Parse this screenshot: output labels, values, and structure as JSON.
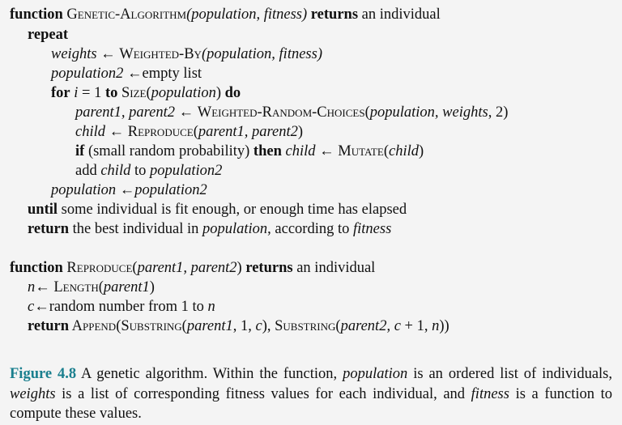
{
  "colors": {
    "background": "#f4f4f4",
    "text": "#111111",
    "figure_label": "#1a7f8e"
  },
  "algorithm1": {
    "header": {
      "kw_function": "function",
      "name": "Genetic-Algorithm",
      "params": "(population, fitness)",
      "kw_returns": "returns",
      "returns_text": "an individual"
    },
    "l_repeat": {
      "kw": "repeat"
    },
    "l_weights": {
      "var": "weights",
      "arrow": "←",
      "fn": "Weighted-By",
      "args": "(population, fitness)"
    },
    "l_pop2": {
      "var": "population2",
      "arrow": "←",
      "rest": "empty list"
    },
    "l_for": {
      "kw_for": "for",
      "iter": "i",
      "eq": " = 1 ",
      "kw_to": "to",
      "fn": " Size",
      "arg_open": "(",
      "arg": "population",
      "arg_close": ")",
      "kw_do": "do"
    },
    "l_parents": {
      "vars": "parent1, parent2",
      "arrow": "←",
      "fn": "Weighted-Random-Choices",
      "open": "(",
      "args": "population, weights",
      "close": ", 2)"
    },
    "l_child": {
      "var": "child",
      "arrow": "←",
      "fn": "Reproduce",
      "open": "(",
      "args": "parent1, parent2",
      "close": ")"
    },
    "l_if": {
      "kw_if": "if",
      "cond": " (small random probability) ",
      "kw_then": "then",
      "var": "child",
      "arrow": "←",
      "fn": "Mutate",
      "open": "(",
      "arg": "child",
      "close": ")"
    },
    "l_add": {
      "t1": "add ",
      "var1": "child",
      "t2": " to ",
      "var2": "population2"
    },
    "l_assign": {
      "var1": "population",
      "arrow": "←",
      "var2": "population2"
    },
    "l_until": {
      "kw": "until",
      "text": " some individual is fit enough, or enough time has elapsed"
    },
    "l_return": {
      "kw": "return",
      "t1": " the best individual in ",
      "var1": "population",
      "t2": ", according to ",
      "var2": "fitness"
    }
  },
  "algorithm2": {
    "header": {
      "kw_function": "function",
      "name": "Reproduce",
      "open": "(",
      "params": "parent1, parent2",
      "close": ")",
      "kw_returns": "returns",
      "returns_text": "an individual"
    },
    "l_n": {
      "var": "n",
      "arrow": "←",
      "fn": "Length",
      "open": "(",
      "arg": "parent1",
      "close": ")"
    },
    "l_c": {
      "var": "c",
      "arrow": "←",
      "t1": "random number from 1 to ",
      "var2": "n"
    },
    "l_ret": {
      "kw": "return",
      "fn1": " Append",
      "p1": "(",
      "fn2": "Substring",
      "p2": "(",
      "a1": "parent1",
      "a1b": ", 1, ",
      "a2": "c",
      "p3": "), ",
      "fn3": "Substring",
      "p4": "(",
      "a3": "parent2",
      "p5": ", ",
      "a4": "c",
      "a4b": " + 1, ",
      "a5": "n",
      "p6": "))"
    }
  },
  "caption": {
    "label": "Figure 4.8",
    "t1": "  A genetic algorithm. Within the function, ",
    "v1": "population",
    "t2": " is an ordered list of individuals, ",
    "v2": "weights",
    "t3": " is a list of corresponding fitness values for each individual, and ",
    "v3": "fitness",
    "t4": " is a function to compute these values."
  }
}
